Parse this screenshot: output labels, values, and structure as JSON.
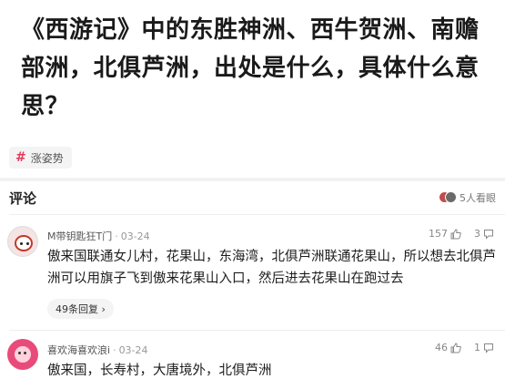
{
  "question": {
    "title": "《西游记》中的东胜神洲、西牛贺洲、南赡部洲，北俱芦洲，出处是什么，具体什么意思？"
  },
  "tag": {
    "label": "涨姿势"
  },
  "comments_section": {
    "title": "评论",
    "viewers_label": "5人看眼"
  },
  "comments": [
    {
      "username": "M带钥匙狂T门",
      "date": "03-24",
      "likes": "157",
      "replies_count": "3",
      "text": "傲来国联通女儿村，花果山，东海湾，北俱芦洲联通花果山，所以想去北俱芦洲可以用旗子飞到傲来花果山入口，然后进去花果山在跑过去",
      "replies_label": "49条回复 ›"
    },
    {
      "username": "喜欢海喜欢浪i",
      "date": "03-24",
      "likes": "46",
      "replies_count": "1",
      "text": "傲来国，长寿村，大唐境外，北俱芦洲"
    }
  ],
  "icons": {
    "tag": "hash-icon",
    "like": "thumb-up-icon",
    "reply": "comment-bubble-icon",
    "viewers": "stacked-avatars-icon"
  },
  "colors": {
    "accent": "#e33a5a",
    "text": "#1c1c1c",
    "muted": "#999999"
  }
}
